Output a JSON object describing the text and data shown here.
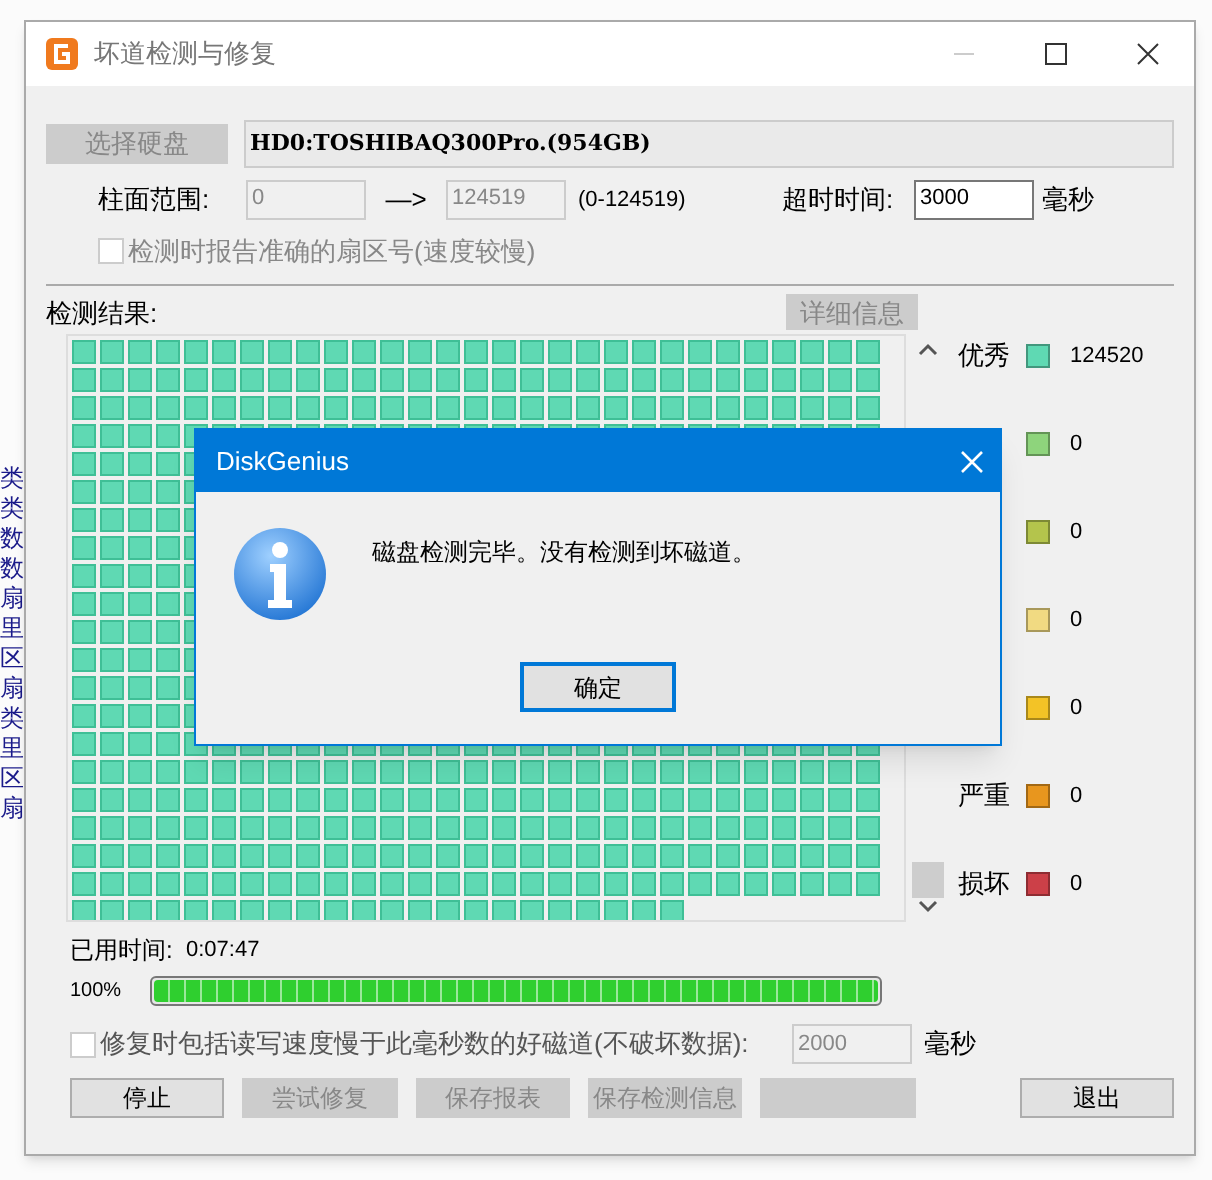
{
  "background_app": {
    "left_fragments": [
      "类",
      "类",
      "数",
      "数",
      "扇",
      "里",
      "区",
      "扇",
      "类",
      "里",
      "区",
      "扇"
    ]
  },
  "window": {
    "title": "坏道检测与修复"
  },
  "disk": {
    "button": "选择硬盘",
    "button_disabled": true,
    "name": "HD0:TOSHIBAQ300Pro.(954GB)"
  },
  "range": {
    "label": "柱面范围:",
    "from": "0",
    "arrow": "—>",
    "to": "124519",
    "hint": "(0-124519)",
    "timeout_label": "超时时间:",
    "timeout": "3000",
    "timeout_unit": "毫秒"
  },
  "report_exact": {
    "label": "检测时报告准确的扇区号(速度较慢)",
    "checked": false,
    "disabled": true
  },
  "results": {
    "label": "检测结果:",
    "details_button": "详细信息"
  },
  "legend": [
    {
      "label": "优秀",
      "color": "#5fd9b3",
      "count": "124520"
    },
    {
      "color": "#8ed47c",
      "count": "0"
    },
    {
      "color": "#b4c44c",
      "count": "0"
    },
    {
      "color": "#f1da82",
      "count": "0"
    },
    {
      "color": "#f3c326",
      "count": "0"
    },
    {
      "label": "严重",
      "color": "#e8961e",
      "count": "0"
    },
    {
      "label": "损坏",
      "color": "#cc4048",
      "count": "0"
    }
  ],
  "elapsed": {
    "label": "已用时间:",
    "value": "0:07:47"
  },
  "progress": {
    "reading": "100%",
    "level": 1
  },
  "repair_slow": {
    "label": "修复时包括读写速度慢于此毫秒数的好磁道(不破坏数据):",
    "checked": false,
    "value": "2000",
    "unit": "毫秒"
  },
  "buttons": [
    {
      "label": "停止",
      "disabled": false
    },
    {
      "label": "尝试修复",
      "disabled": true
    },
    {
      "label": "保存报表",
      "disabled": true
    },
    {
      "label": "保存检测信息",
      "disabled": true
    },
    {
      "disabled": true
    },
    {
      "label": "退出",
      "disabled": false
    }
  ],
  "message_box": {
    "title": "DiskGenius",
    "message": "磁盘检测完毕。没有检测到坏磁道。",
    "ok": "确定"
  }
}
